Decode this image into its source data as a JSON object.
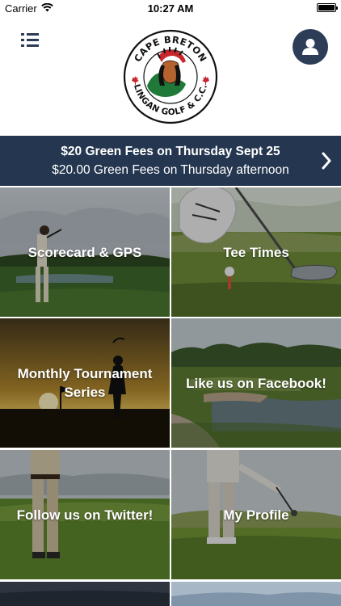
{
  "status_bar": {
    "carrier": "Carrier",
    "time": "10:27 AM",
    "wifi_icon": "wifi-icon",
    "battery_icon": "battery-icon"
  },
  "header": {
    "menu_icon": "list-menu-icon",
    "profile_icon": "user-icon",
    "logo": {
      "top_text": "CAPE BRETON",
      "bottom_text": "LINGAN GOLF & C.C."
    }
  },
  "banner": {
    "title": "$20 Green Fees on Thursday Sept 25",
    "subtitle": "$20.00 Green Fees on Thursday afternoon",
    "chevron_icon": "chevron-right-icon"
  },
  "tiles": [
    {
      "label": "Scorecard & GPS"
    },
    {
      "label": "Tee Times"
    },
    {
      "label": "Monthly Tournament Series"
    },
    {
      "label": "Like us on Facebook!"
    },
    {
      "label": "Follow us on Twitter!"
    },
    {
      "label": "My Profile"
    }
  ],
  "colors": {
    "brand_navy": "#253750",
    "icon_navy": "#2d3b55",
    "logo_green": "#1f7a3a",
    "logo_red": "#c8262c"
  }
}
